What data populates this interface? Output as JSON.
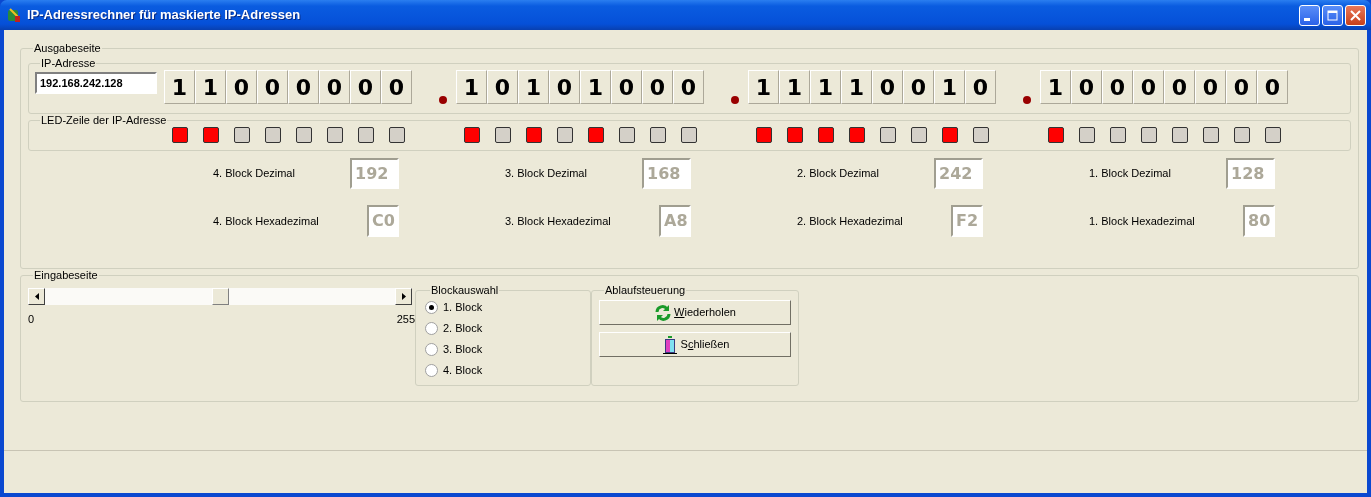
{
  "window": {
    "title": "IP-Adressrechner für maskierte IP-Adressen"
  },
  "output_page": {
    "title": "Ausgabeseite",
    "ip_address": {
      "title": "IP-Adresse",
      "value": "192.168.242.128"
    },
    "led_row": {
      "title": "LED-Zeile der IP-Adresse"
    },
    "blocks": [
      {
        "bits": [
          {
            "digit": "1",
            "led_on": true
          },
          {
            "digit": "1",
            "led_on": true
          },
          {
            "digit": "0",
            "led_on": false
          },
          {
            "digit": "0",
            "led_on": false
          },
          {
            "digit": "0",
            "led_on": false
          },
          {
            "digit": "0",
            "led_on": false
          },
          {
            "digit": "0",
            "led_on": false
          },
          {
            "digit": "0",
            "led_on": false
          }
        ],
        "decimal_label": "4. Block Dezimal",
        "decimal": "192",
        "hex_label": "4. Block Hexadezimal",
        "hex": "C0"
      },
      {
        "bits": [
          {
            "digit": "1",
            "led_on": true
          },
          {
            "digit": "0",
            "led_on": false
          },
          {
            "digit": "1",
            "led_on": true
          },
          {
            "digit": "0",
            "led_on": false
          },
          {
            "digit": "1",
            "led_on": true
          },
          {
            "digit": "0",
            "led_on": false
          },
          {
            "digit": "0",
            "led_on": false
          },
          {
            "digit": "0",
            "led_on": false
          }
        ],
        "decimal_label": "3. Block Dezimal",
        "decimal": "168",
        "hex_label": "3. Block Hexadezimal",
        "hex": "A8"
      },
      {
        "bits": [
          {
            "digit": "1",
            "led_on": true
          },
          {
            "digit": "1",
            "led_on": true
          },
          {
            "digit": "1",
            "led_on": true
          },
          {
            "digit": "1",
            "led_on": true
          },
          {
            "digit": "0",
            "led_on": false
          },
          {
            "digit": "0",
            "led_on": false
          },
          {
            "digit": "1",
            "led_on": true
          },
          {
            "digit": "0",
            "led_on": false
          }
        ],
        "decimal_label": "2. Block Dezimal",
        "decimal": "242",
        "hex_label": "2. Block Hexadezimal",
        "hex": "F2"
      },
      {
        "bits": [
          {
            "digit": "1",
            "led_on": true
          },
          {
            "digit": "0",
            "led_on": false
          },
          {
            "digit": "0",
            "led_on": false
          },
          {
            "digit": "0",
            "led_on": false
          },
          {
            "digit": "0",
            "led_on": false
          },
          {
            "digit": "0",
            "led_on": false
          },
          {
            "digit": "0",
            "led_on": false
          },
          {
            "digit": "0",
            "led_on": false
          }
        ],
        "decimal_label": "1. Block Dezimal",
        "decimal": "128",
        "hex_label": "1. Block Hexadezimal",
        "hex": "80"
      }
    ]
  },
  "input_page": {
    "title": "Eingabeseite",
    "slider": {
      "level": 0.5,
      "min_label": "0",
      "max_label": "255"
    },
    "block_select": {
      "title": "Blockauswahl",
      "options": [
        {
          "label": "1. Block",
          "selected": true
        },
        {
          "label": "2. Block",
          "selected": false
        },
        {
          "label": "3. Block",
          "selected": false
        },
        {
          "label": "4. Block",
          "selected": false
        }
      ]
    },
    "control": {
      "title": "Ablaufsteuerung",
      "buttons": [
        {
          "key": "W",
          "post": "iederholen"
        },
        {
          "pre": "S",
          "key": "c",
          "post": "hließen"
        }
      ]
    }
  }
}
